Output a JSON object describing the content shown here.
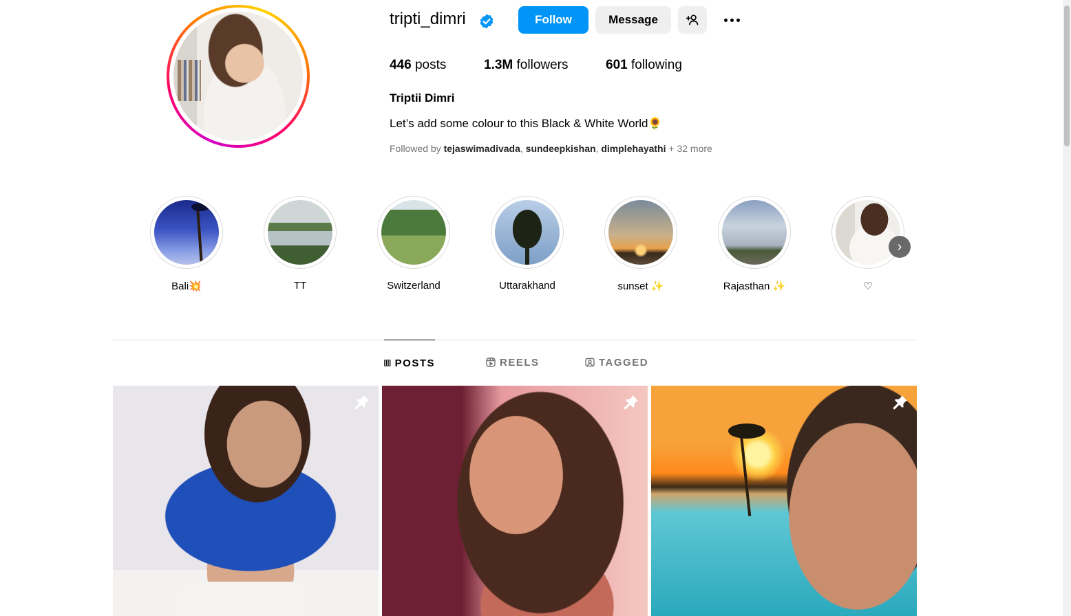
{
  "profile": {
    "username": "tripti_dimri",
    "verified": true,
    "follow_label": "Follow",
    "message_label": "Message",
    "stats": {
      "posts_count": "446",
      "posts_label": "posts",
      "followers_count": "1.3M",
      "followers_label": "followers",
      "following_count": "601",
      "following_label": "following"
    },
    "full_name": "Triptii Dimri",
    "bio": "Let’s add some colour to this Black & White World🌻",
    "followed_by": {
      "prefix": "Followed by",
      "users": [
        "tejaswimadivada",
        "sundeepkishan",
        "dimplehayathi"
      ],
      "more": "+ 32 more"
    }
  },
  "highlights": [
    {
      "label": "Bali💥"
    },
    {
      "label": "TT"
    },
    {
      "label": "Switzerland"
    },
    {
      "label": "Uttarakhand"
    },
    {
      "label": "sunset ✨"
    },
    {
      "label": "Rajasthan ✨"
    },
    {
      "label": "♡"
    }
  ],
  "tabs": [
    {
      "label": "POSTS",
      "icon": "grid-icon",
      "active": true
    },
    {
      "label": "REELS",
      "icon": "reels-icon",
      "active": false
    },
    {
      "label": "TAGGED",
      "icon": "tagged-icon",
      "active": false
    }
  ],
  "posts": [
    {
      "pinned": true
    },
    {
      "pinned": true
    },
    {
      "pinned": true
    }
  ],
  "colors": {
    "accent": "#0095f6",
    "secondary_button": "#efefef",
    "muted_text": "#737373"
  }
}
